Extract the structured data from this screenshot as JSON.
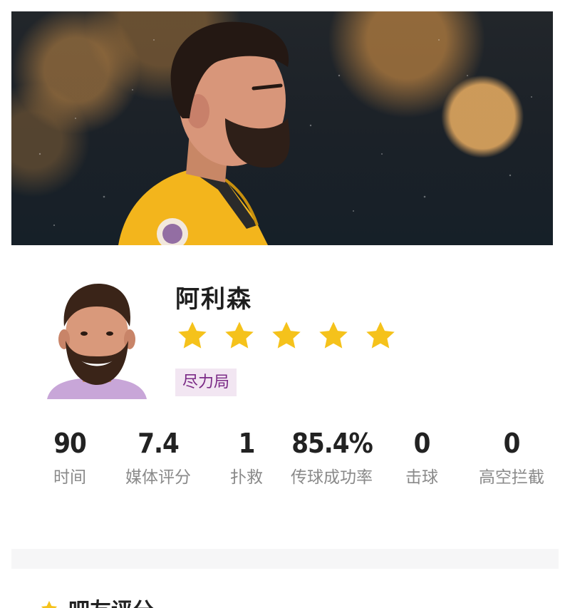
{
  "player": {
    "name": "阿利森",
    "rating_stars": 5,
    "badge": "尽力局"
  },
  "stats": [
    {
      "value": "90",
      "label": "时间"
    },
    {
      "value": "7.4",
      "label": "媒体评分"
    },
    {
      "value": "1",
      "label": "扑救"
    },
    {
      "value": "85.4%",
      "label": "传球成功率"
    },
    {
      "value": "0",
      "label": "击球"
    },
    {
      "value": "0",
      "label": "高空拦截"
    }
  ],
  "section": {
    "title": "吧友评分"
  },
  "colors": {
    "star": "#f5c21b",
    "badge_bg": "#f2e6f2",
    "badge_text": "#7b2a86",
    "jersey": "#f3b51c"
  }
}
